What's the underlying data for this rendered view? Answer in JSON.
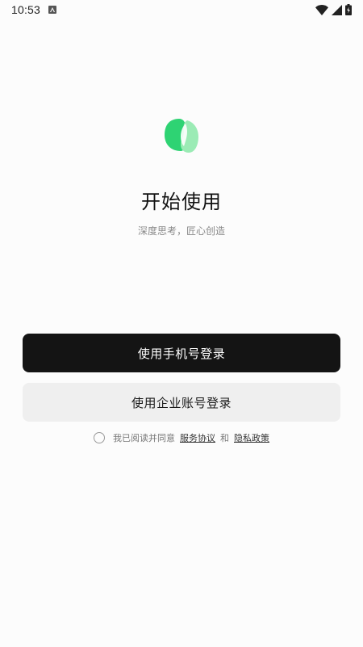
{
  "status_bar": {
    "time": "10:53",
    "notification_icon": "a-notification-icon",
    "wifi_icon": "wifi-icon",
    "signal_icon": "signal-icon",
    "battery_icon": "battery-charging-icon"
  },
  "brand": {
    "logo_icon": "app-logo",
    "accent_color": "#2ed373",
    "accent_light": "#9bebb5"
  },
  "hero": {
    "title": "开始使用",
    "subtitle": "深度思考，匠心创造"
  },
  "actions": {
    "phone_login_label": "使用手机号登录",
    "enterprise_login_label": "使用企业账号登录"
  },
  "agreement": {
    "prefix": "我已阅读并同意",
    "terms_label": "服务协议",
    "conjunction": "和",
    "privacy_label": "隐私政策"
  }
}
